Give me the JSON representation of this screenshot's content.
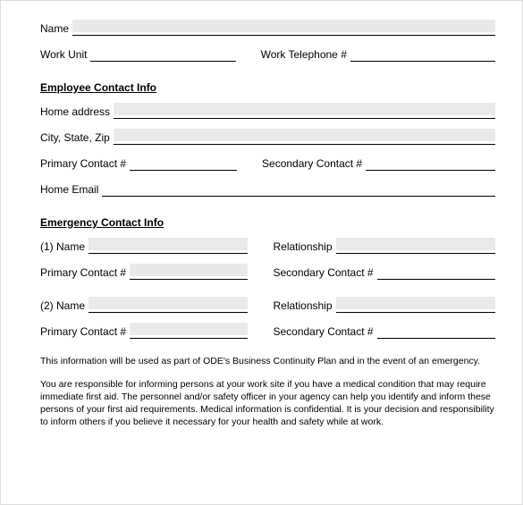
{
  "top": {
    "name": "Name",
    "work_unit": "Work Unit",
    "work_tel": "Work Telephone #"
  },
  "employee_section": "Employee Contact Info",
  "employee": {
    "home_address": "Home address",
    "city_state_zip": "City, State, Zip",
    "primary_contact": "Primary Contact #",
    "secondary_contact": "Secondary Contact #",
    "home_email": "Home Email"
  },
  "emergency_section": "Emergency Contact Info",
  "emergency": {
    "name1": "(1) Name",
    "name2": "(2) Name",
    "relationship": "Relationship",
    "primary_contact": "Primary Contact #",
    "secondary_contact": "Secondary Contact #"
  },
  "disclaimer1": "This information will be used as part of ODE's Business Continuity Plan and in the event of an emergency.",
  "disclaimer2": "You are responsible for informing persons at your work site if you have a medical condition that may require immediate first aid.  The personnel and/or safety officer in your agency can help you identify and inform these persons of your first aid requirements.  Medical information is confidential.  It is your decision and responsibility to inform others if you believe it necessary for your health and safety while at work."
}
